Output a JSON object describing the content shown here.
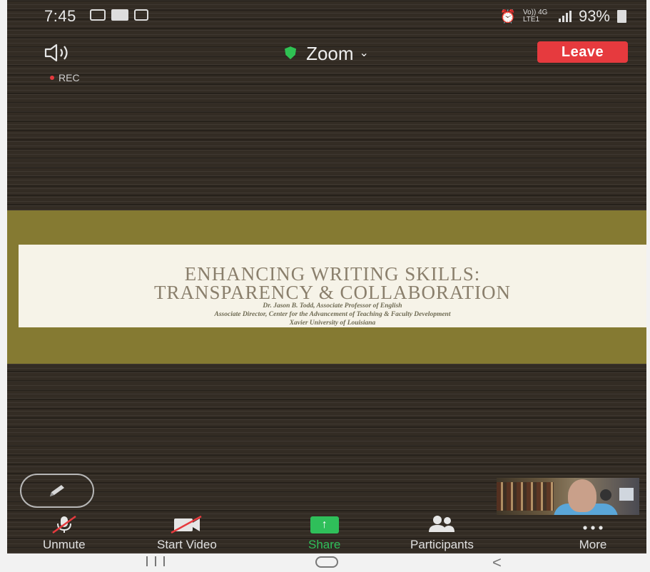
{
  "status_bar": {
    "time": "7:45",
    "network": "Vo)) 4G LTE1",
    "battery": "93%"
  },
  "meeting": {
    "title": "Zoom",
    "leave_label": "Leave",
    "rec_label": "REC"
  },
  "slide": {
    "title_line1": "ENHANCING WRITING SKILLS:",
    "title_line2": "TRANSPARENCY & COLLABORATION",
    "subtitle_line1": "Dr. Jason B. Todd, Associate Professor of English",
    "subtitle_line2": "Associate Director, Center for the Advancement of Teaching & Faculty Development",
    "subtitle_line3": "Xavier University of Louisiana"
  },
  "toolbar": {
    "items": [
      {
        "label": "Unmute",
        "icon": "mic-muted-icon"
      },
      {
        "label": "Start Video",
        "icon": "video-off-icon"
      },
      {
        "label": "Share",
        "icon": "share-up-arrow-icon"
      },
      {
        "label": "Participants",
        "icon": "participants-icon"
      },
      {
        "label": "More",
        "icon": "more-dots-icon"
      }
    ]
  },
  "colors": {
    "leave": "#e63a3e",
    "share": "#2fbf5a",
    "shield": "#2fc253",
    "slide_band": "#857a32"
  }
}
